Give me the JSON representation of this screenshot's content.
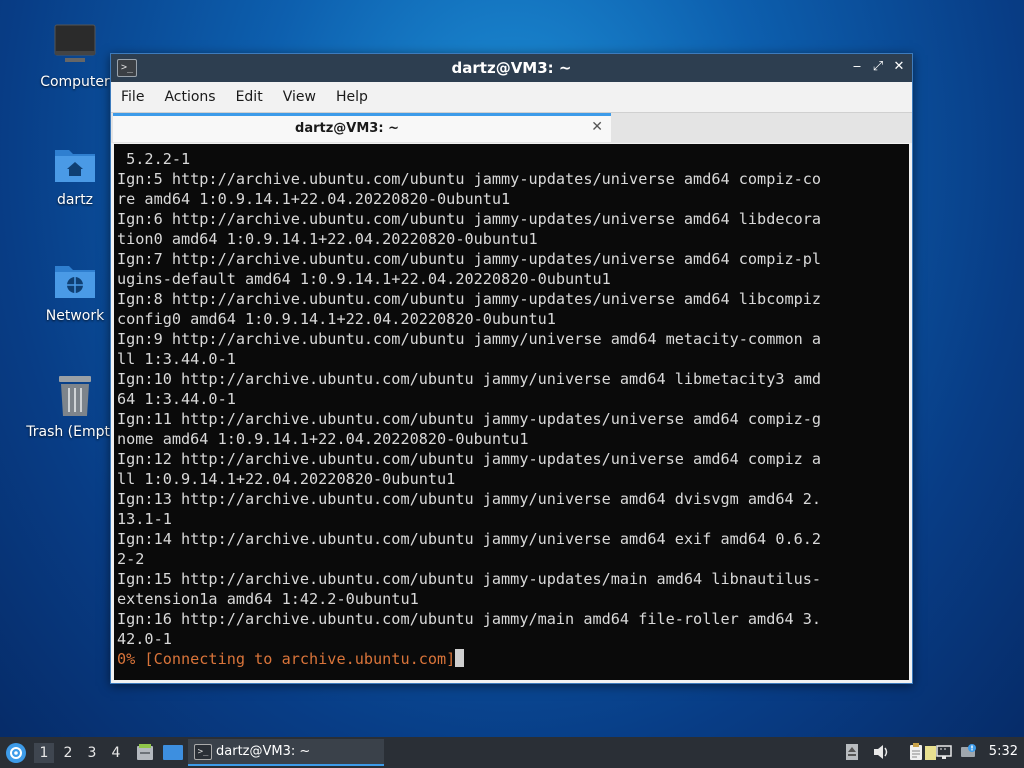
{
  "desktop": {
    "icons": [
      {
        "label": "Computer"
      },
      {
        "label": "dartz"
      },
      {
        "label": "Network"
      },
      {
        "label": "Trash (Empty)"
      }
    ]
  },
  "window": {
    "title": "dartz@VM3: ~",
    "controls": {
      "minimize": "‒",
      "maximize": "⤢",
      "close": "✕"
    },
    "menu": [
      "File",
      "Actions",
      "Edit",
      "View",
      "Help"
    ],
    "tab": {
      "label": "dartz@VM3: ~",
      "close": "✕"
    }
  },
  "terminal": {
    "lines": [
      " 5.2.2-1",
      "Ign:5 http://archive.ubuntu.com/ubuntu jammy-updates/universe amd64 compiz-co",
      "re amd64 1:0.9.14.1+22.04.20220820-0ubuntu1",
      "Ign:6 http://archive.ubuntu.com/ubuntu jammy-updates/universe amd64 libdecora",
      "tion0 amd64 1:0.9.14.1+22.04.20220820-0ubuntu1",
      "Ign:7 http://archive.ubuntu.com/ubuntu jammy-updates/universe amd64 compiz-pl",
      "ugins-default amd64 1:0.9.14.1+22.04.20220820-0ubuntu1",
      "Ign:8 http://archive.ubuntu.com/ubuntu jammy-updates/universe amd64 libcompiz",
      "config0 amd64 1:0.9.14.1+22.04.20220820-0ubuntu1",
      "Ign:9 http://archive.ubuntu.com/ubuntu jammy/universe amd64 metacity-common a",
      "ll 1:3.44.0-1",
      "Ign:10 http://archive.ubuntu.com/ubuntu jammy/universe amd64 libmetacity3 amd",
      "64 1:3.44.0-1",
      "Ign:11 http://archive.ubuntu.com/ubuntu jammy-updates/universe amd64 compiz-g",
      "nome amd64 1:0.9.14.1+22.04.20220820-0ubuntu1",
      "Ign:12 http://archive.ubuntu.com/ubuntu jammy-updates/universe amd64 compiz a",
      "ll 1:0.9.14.1+22.04.20220820-0ubuntu1",
      "Ign:13 http://archive.ubuntu.com/ubuntu jammy/universe amd64 dvisvgm amd64 2.",
      "13.1-1",
      "Ign:14 http://archive.ubuntu.com/ubuntu jammy/universe amd64 exif amd64 0.6.2",
      "2-2",
      "Ign:15 http://archive.ubuntu.com/ubuntu jammy-updates/main amd64 libnautilus-",
      "extension1a amd64 1:42.2-0ubuntu1",
      "Ign:16 http://archive.ubuntu.com/ubuntu jammy/main amd64 file-roller amd64 3.",
      "42.0-1"
    ],
    "status_line": "0% [Connecting to archive.ubuntu.com]",
    "colors": {
      "background": "#0a0a0a",
      "text": "#d9d9d9",
      "status": "#d9743a"
    }
  },
  "taskbar": {
    "workspaces": [
      "1",
      "2",
      "3",
      "4"
    ],
    "active_workspace": "1",
    "task": {
      "label": "dartz@VM3: ~"
    },
    "clock": "5:32"
  }
}
